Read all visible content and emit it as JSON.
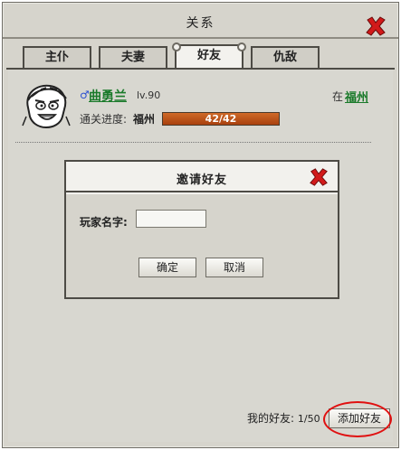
{
  "window": {
    "title": "关系",
    "close_icon": "close-x-icon"
  },
  "tabs": [
    {
      "label": "主仆",
      "active": false
    },
    {
      "label": "夫妻",
      "active": false
    },
    {
      "label": "好友",
      "active": true
    },
    {
      "label": "仇敌",
      "active": false
    }
  ],
  "friend": {
    "gender_icon": "male-symbol-icon",
    "gender_symbol": "♂",
    "name": "曲勇兰",
    "level": "lv.90",
    "location_prefix": "在",
    "location": "福州",
    "progress_label": "通关进度:",
    "progress_city": "福州",
    "progress_text": "42/42",
    "progress_fraction": 1.0,
    "avatar_icon": "warrior-portrait-icon"
  },
  "dialog": {
    "title": "邀请好友",
    "field_label": "玩家名字:",
    "field_value": "",
    "field_placeholder": "",
    "confirm_label": "确定",
    "cancel_label": "取消",
    "close_icon": "close-x-icon"
  },
  "footer": {
    "friend_count_label": "我的好友:",
    "friend_count_value": "1/50",
    "add_button_label": "添加好友"
  },
  "colors": {
    "accent_red": "#e01010",
    "name_green": "#1a7a2a",
    "progress_fill": "#c2561c"
  }
}
